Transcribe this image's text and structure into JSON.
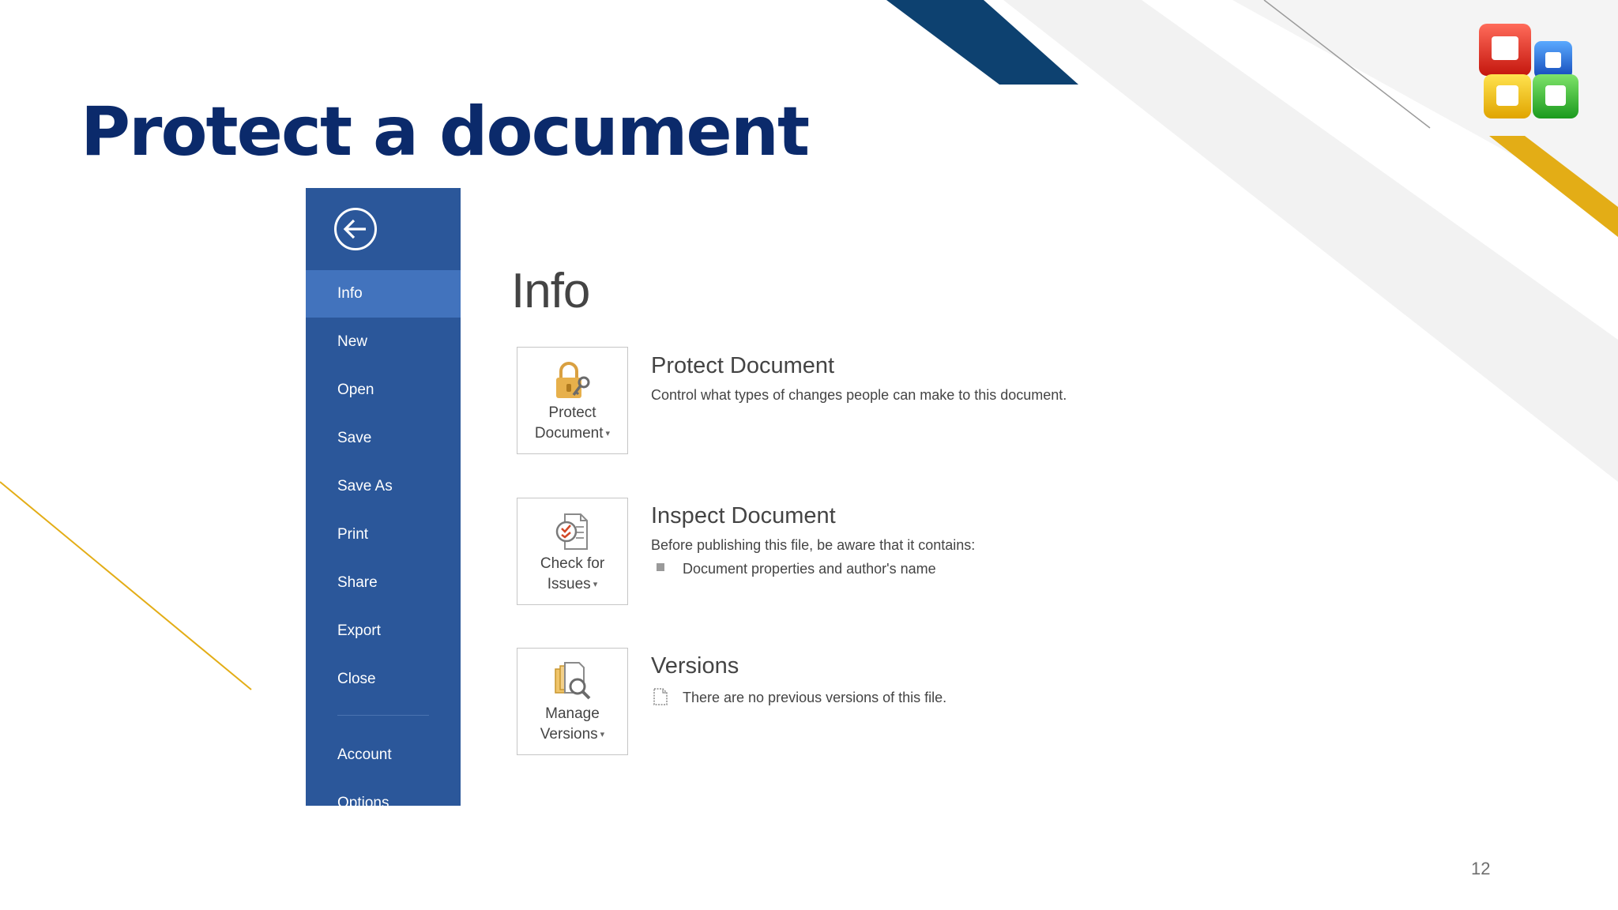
{
  "slide": {
    "title": "Protect a document",
    "page_number": "12",
    "logo_icon": "office-logo-icon"
  },
  "colors": {
    "title": "#0b2a6b",
    "sidebar_bg": "#2b579a",
    "sidebar_selected": "#4273bd",
    "accent_navy": "#0d4170",
    "accent_gold": "#e3ad16",
    "lock_gold": "#e7b04b"
  },
  "backstage": {
    "back_icon": "back-arrow-icon",
    "nav": [
      {
        "label": "Info",
        "selected": true
      },
      {
        "label": "New"
      },
      {
        "label": "Open"
      },
      {
        "label": "Save"
      },
      {
        "label": "Save As"
      },
      {
        "label": "Print"
      },
      {
        "label": "Share"
      },
      {
        "label": "Export"
      },
      {
        "label": "Close"
      },
      {
        "label": "Account"
      },
      {
        "label": "Options"
      }
    ],
    "heading": "Info",
    "sections": [
      {
        "button_line1": "Protect",
        "button_line2": "Document",
        "icon": "lock-key-icon",
        "title": "Protect Document",
        "description": "Control what types of changes people can make to this document."
      },
      {
        "button_line1": "Check for",
        "button_line2": "Issues",
        "icon": "inspect-document-icon",
        "title": "Inspect Document",
        "description": "Before publishing this file, be aware that it contains:",
        "bullets": [
          "Document properties and author's name"
        ]
      },
      {
        "button_line1": "Manage",
        "button_line2": "Versions",
        "icon": "manage-versions-icon",
        "title": "Versions",
        "description": "There are no previous versions of this file."
      }
    ]
  }
}
